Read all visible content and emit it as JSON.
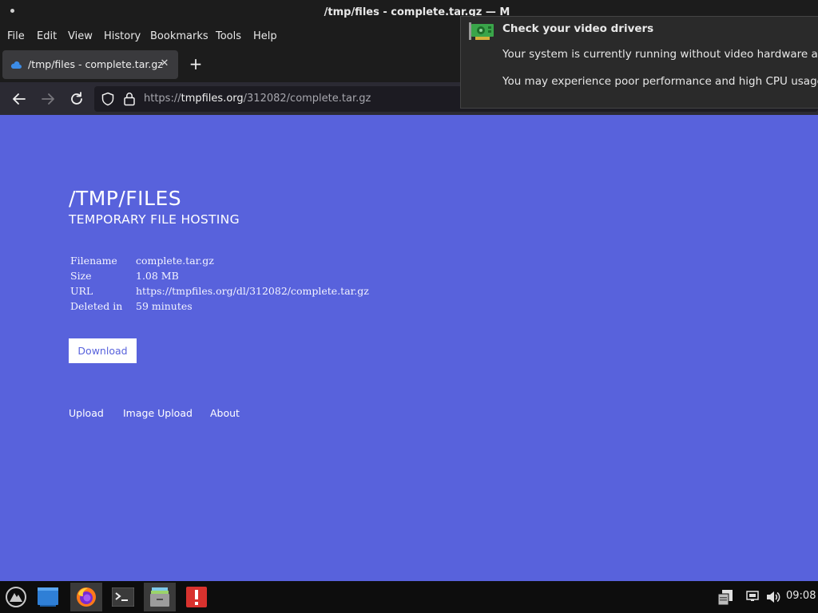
{
  "window": {
    "title": "/tmp/files - complete.tar.gz — M"
  },
  "menu": {
    "items": [
      {
        "label": "File"
      },
      {
        "label": "Edit"
      },
      {
        "label": "View"
      },
      {
        "label": "History"
      },
      {
        "label": "Bookmarks"
      },
      {
        "label": "Tools"
      },
      {
        "label": "Help"
      }
    ]
  },
  "tabs": {
    "active_title": "/tmp/files - complete.tar.gz",
    "close_glyph": "✕",
    "new_tab_glyph": "+"
  },
  "urlbar": {
    "prefix": "https://",
    "domain": "tmpfiles.org",
    "path": "/312082/complete.tar.gz"
  },
  "page": {
    "site_title": "/TMP/FILES",
    "site_subtitle": "TEMPORARY FILE HOSTING",
    "file_info": [
      {
        "key": "Filename",
        "value": "complete.tar.gz"
      },
      {
        "key": "Size",
        "value": "1.08 MB"
      },
      {
        "key": "URL",
        "value": "https://tmpfiles.org/dl/312082/complete.tar.gz"
      },
      {
        "key": "Deleted in",
        "value": "59 minutes"
      }
    ],
    "download_label": "Download",
    "footer_links": [
      {
        "label": "Upload"
      },
      {
        "label": "Image Upload"
      },
      {
        "label": "About"
      }
    ]
  },
  "notification": {
    "title": "Check your video drivers",
    "line1": "Your system is currently running without video hardware acceler",
    "line2": "You may experience poor performance and high CPU usage."
  },
  "taskbar": {
    "apps": [
      "start-menu-icon",
      "desktop-icon",
      "firefox-icon",
      "terminal-icon",
      "files-icon",
      "alert-app-icon"
    ],
    "clock": "09:08"
  },
  "colors": {
    "page_bg": "#5862dc",
    "chrome_bg": "#1c1c1c",
    "urlbar_bg": "#1c1b22"
  }
}
